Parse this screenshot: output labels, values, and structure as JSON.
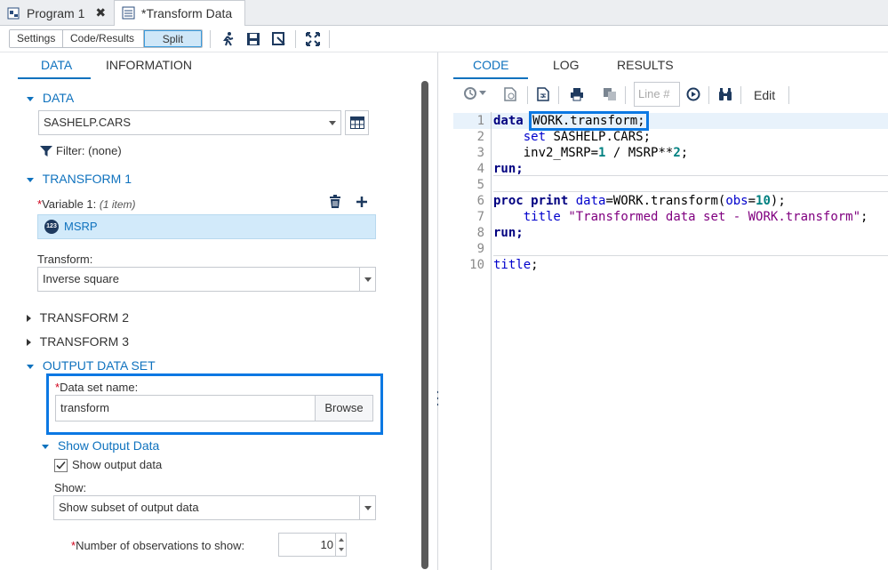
{
  "tabs": [
    {
      "label": "Program 1",
      "close": "✖"
    },
    {
      "label": "*Transform Data",
      "close": ""
    }
  ],
  "toolbar": {
    "views": [
      "Settings",
      "Code/Results",
      "Split"
    ],
    "active_view": "Split"
  },
  "left": {
    "tabs": [
      "DATA",
      "INFORMATION"
    ],
    "data_section": {
      "heading": "DATA",
      "dataset": "SASHELP.CARS",
      "filter": "Filter: (none)"
    },
    "transform1": {
      "heading": "TRANSFORM 1",
      "var_label": "Variable 1:",
      "var_count": "(1 item)",
      "var_badge": "123",
      "var_name": "MSRP",
      "transform_label": "Transform:",
      "transform_value": "Inverse square"
    },
    "transform2": "TRANSFORM 2",
    "transform3": "TRANSFORM 3",
    "output": {
      "heading": "OUTPUT DATA SET",
      "name_label": "Data set name:",
      "name_value": "transform",
      "browse": "Browse",
      "show_heading": "Show Output Data",
      "show_checkbox": "Show output data",
      "show_label": "Show:",
      "show_value": "Show subset of output data",
      "obs_label": "Number of observations to show:",
      "obs_value": "10"
    }
  },
  "right": {
    "tabs": [
      "CODE",
      "LOG",
      "RESULTS"
    ],
    "line_placeholder": "Line #",
    "edit": "Edit",
    "lines": [
      "1",
      "2",
      "3",
      "4",
      "5",
      "6",
      "7",
      "8",
      "9",
      "10"
    ],
    "code": {
      "l1_kw": "data",
      "l1_rest": "WORK.transform;",
      "l2_kw": "set",
      "l2_rest": " SASHELP.CARS;",
      "l3_a": "inv2_MSRP=",
      "l3_n1": "1",
      "l3_b": " / MSRP**",
      "l3_n2": "2",
      "l3_c": ";",
      "l4": "run;",
      "l6_kw": "proc print",
      "l6_opt": "data",
      "l6_a": "=WORK.transform(",
      "l6_obs": "obs",
      "l6_b": "=",
      "l6_n": "10",
      "l6_c": ");",
      "l7_kw": "title",
      "l7_str": "\"Transformed data set - WORK.transform\"",
      "l7_c": ";",
      "l8": "run;",
      "l10_kw": "title",
      "l10_c": ";"
    }
  }
}
